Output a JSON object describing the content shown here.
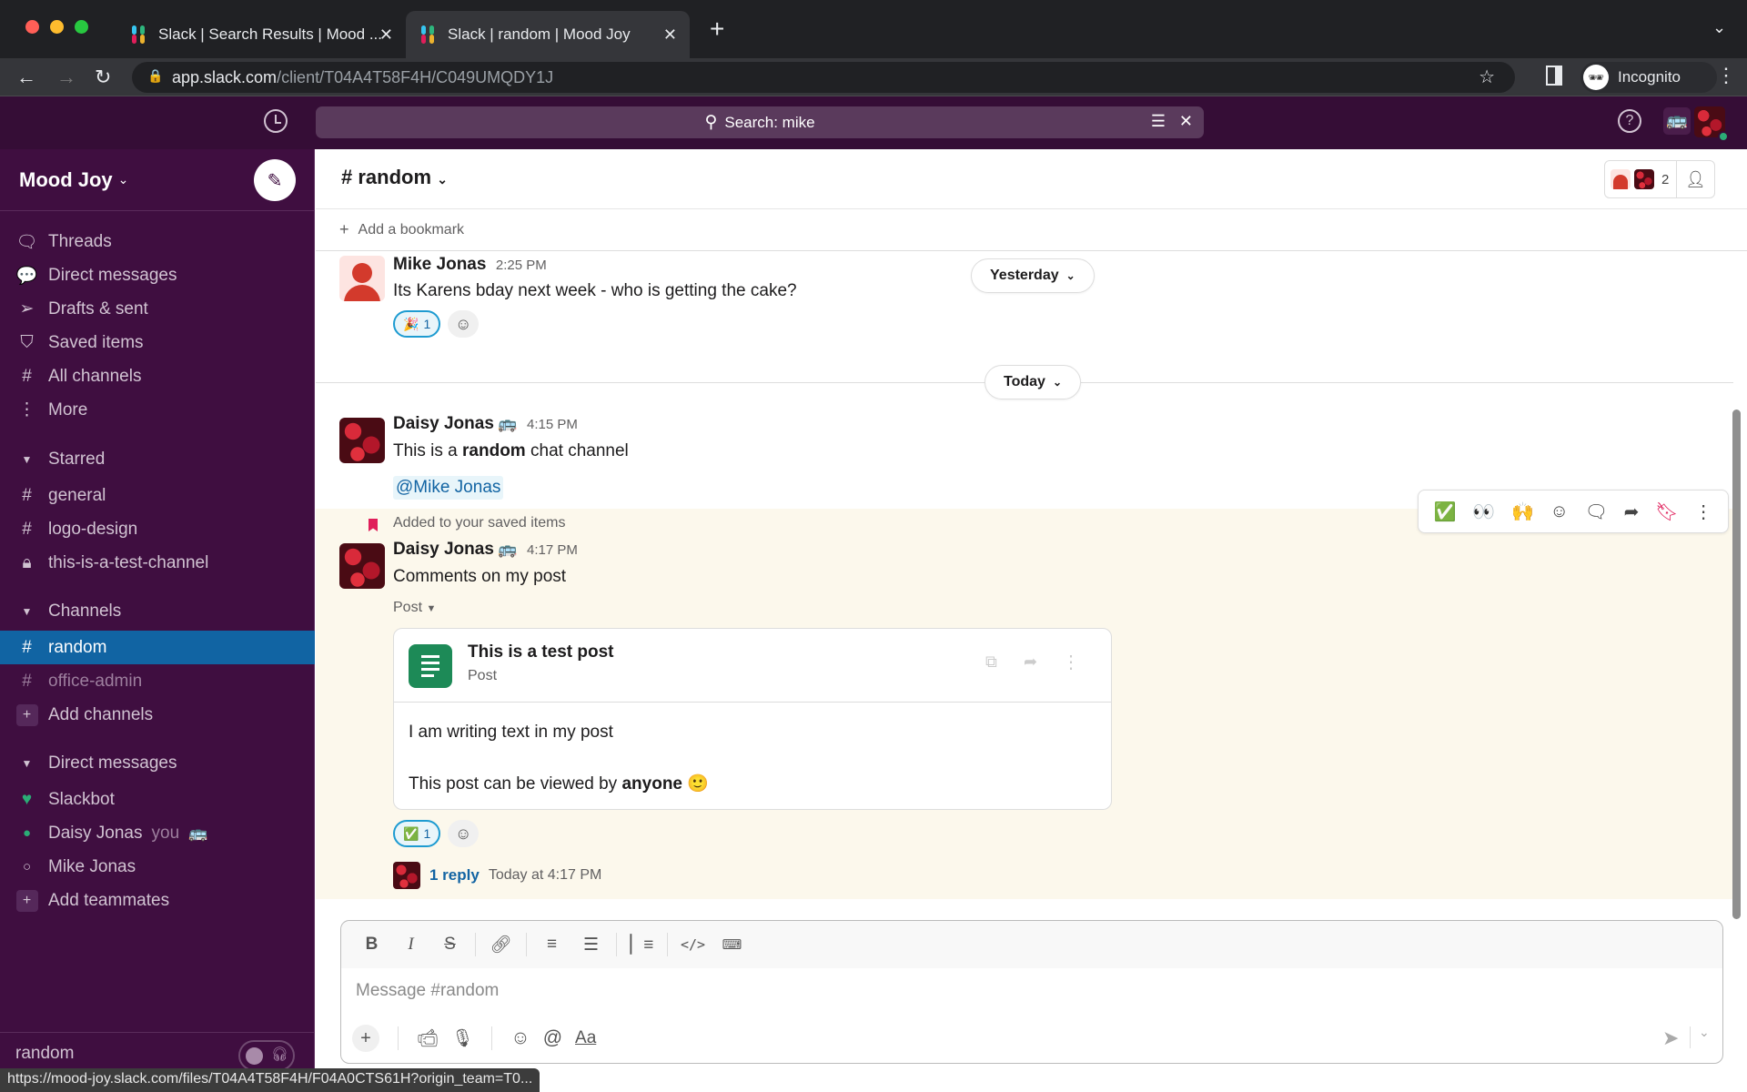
{
  "browser": {
    "tabs": [
      {
        "title": "Slack | Search Results | Mood ...",
        "active": false
      },
      {
        "title": "Slack | random | Mood Joy",
        "active": true
      }
    ],
    "new_tab": "+",
    "url_host": "app.slack.com",
    "url_path": "/client/T04A4T58F4H/C049UMQDY1J",
    "profile_label": "Incognito",
    "status_url": "https://mood-joy.slack.com/files/T04A4T58F4H/F04A0CTS61H?origin_team=T0..."
  },
  "topbar": {
    "search_label": "Search: mike"
  },
  "sidebar": {
    "workspace": "Mood Joy",
    "nav": [
      {
        "icon": "threads-icon",
        "label": "Threads"
      },
      {
        "icon": "direct-messages-icon",
        "label": "Direct messages"
      },
      {
        "icon": "send-icon",
        "label": "Drafts & sent"
      },
      {
        "icon": "bookmark-icon",
        "label": "Saved items"
      },
      {
        "icon": "channel-browse-icon",
        "label": "All channels"
      },
      {
        "icon": "more-icon",
        "label": "More"
      }
    ],
    "starred_heading": "Starred",
    "starred": [
      {
        "prefix": "#",
        "label": "general"
      },
      {
        "prefix": "#",
        "label": "logo-design"
      },
      {
        "prefix": "lock",
        "label": "this-is-a-test-channel"
      }
    ],
    "channels_heading": "Channels",
    "channels": [
      {
        "label": "random",
        "active": true
      },
      {
        "label": "office-admin",
        "muted": true
      }
    ],
    "add_channels": "Add channels",
    "dm_heading": "Direct messages",
    "dms": [
      {
        "label": "Slackbot",
        "status": "heart"
      },
      {
        "label": "Daisy Jonas",
        "you": "you",
        "status": "online"
      },
      {
        "label": "Mike Jonas",
        "status": "away"
      }
    ],
    "add_teammates": "Add teammates",
    "footer_label": "random"
  },
  "channel": {
    "name": "random",
    "member_count": "2",
    "add_bookmark": "Add a bookmark"
  },
  "day_dividers": {
    "yesterday": "Yesterday",
    "today": "Today"
  },
  "messages": [
    {
      "author": "Mike Jonas",
      "time": "2:25 PM",
      "text": "Its Karens bday next week - who is getting the cake?",
      "reaction": {
        "emoji": "🎉",
        "count": "1"
      }
    },
    {
      "author": "Daisy Jonas",
      "time": "4:15 PM",
      "text_pre": "This is a ",
      "text_bold": "random",
      "text_post": " chat channel",
      "mention": "@Mike Jonas"
    },
    {
      "saved_label": "Added to your saved items",
      "author": "Daisy Jonas",
      "time": "4:17 PM",
      "text": "Comments on my post",
      "attachment_toggle": "Post",
      "post": {
        "title": "This is a test post",
        "type": "Post",
        "line1": "I am writing text in my post",
        "line2_pre": "This post can be viewed by ",
        "line2_bold": "anyone",
        "line2_emoji": "🙂"
      },
      "reaction": {
        "emoji": "✅",
        "count": "1"
      },
      "replies": "1 reply",
      "last_reply": "Today at 4:17 PM"
    }
  ],
  "hover_toolbar": [
    "✅",
    "👀",
    "🙌"
  ],
  "composer": {
    "placeholder": "Message #random"
  }
}
